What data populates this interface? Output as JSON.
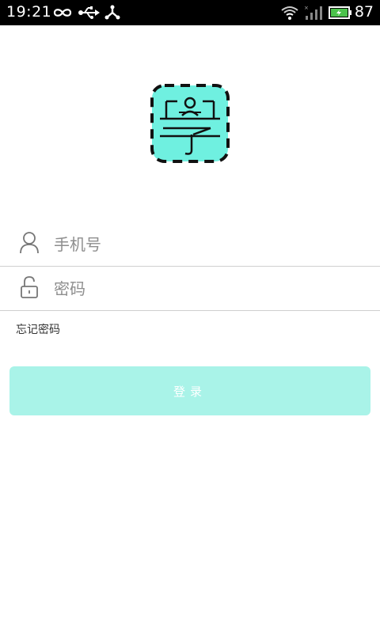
{
  "status_bar": {
    "time": "19:21",
    "battery": "87",
    "icons": [
      "infinity-icon",
      "usb-icon",
      "share-icon",
      "wifi-icon",
      "signal-icon",
      "battery-icon"
    ]
  },
  "app": {
    "logo_icon": "study-logo-icon",
    "accent_color": "#a9f3e8",
    "logo_color": "#6ff0e0"
  },
  "login_form": {
    "phone_placeholder": "手机号",
    "password_placeholder": "密码",
    "forgot_password": "忘记密码",
    "login_label": "登录"
  }
}
